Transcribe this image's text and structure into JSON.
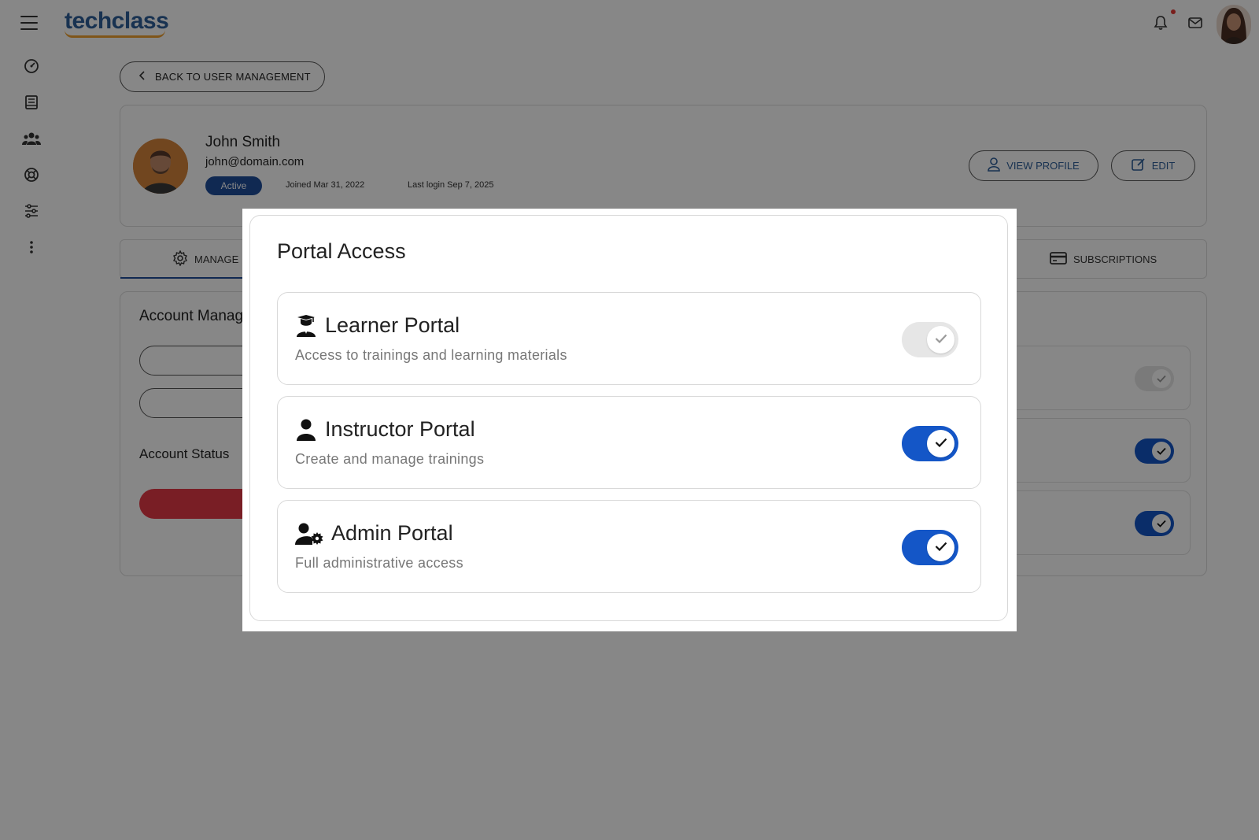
{
  "app": {
    "logo_text": "techclass"
  },
  "colors": {
    "brand_blue": "#1f4e9c",
    "toggle_on": "#1456c7",
    "toggle_off": "#e6e6e6",
    "danger": "#e53946",
    "logo_accent": "#f0a030"
  },
  "header": {
    "icons": [
      "menu-icon",
      "bell-icon",
      "mail-icon",
      "user-avatar"
    ]
  },
  "sidebar": {
    "icons": [
      "dashboard-icon",
      "book-icon",
      "users-icon",
      "support-icon",
      "sliders-icon",
      "more-vertical-icon"
    ]
  },
  "back_button": {
    "label": "BACK TO USER MANAGEMENT"
  },
  "user": {
    "name": "John Smith",
    "email": "john@domain.com",
    "status": "Active",
    "joined": "Joined Mar 31, 2022",
    "last_login": "Last login Sep 7, 2025",
    "view_profile_label": "VIEW PROFILE",
    "edit_label": "EDIT"
  },
  "tabs": [
    {
      "label": "MANAGE"
    },
    {
      "label": "SUBSCRIPTIONS"
    }
  ],
  "account": {
    "title": "Account Manag",
    "status_label": "Account Status"
  },
  "dialog": {
    "title": "Portal Access",
    "portals": [
      {
        "name": "Learner Portal",
        "description": "Access to trainings and learning materials",
        "icon": "graduate-icon",
        "enabled": true,
        "locked": true
      },
      {
        "name": "Instructor Portal",
        "description": "Create and manage trainings",
        "icon": "person-icon",
        "enabled": true,
        "locked": false
      },
      {
        "name": "Admin Portal",
        "description": "Full administrative access",
        "icon": "user-cog-icon",
        "enabled": true,
        "locked": false
      }
    ]
  }
}
